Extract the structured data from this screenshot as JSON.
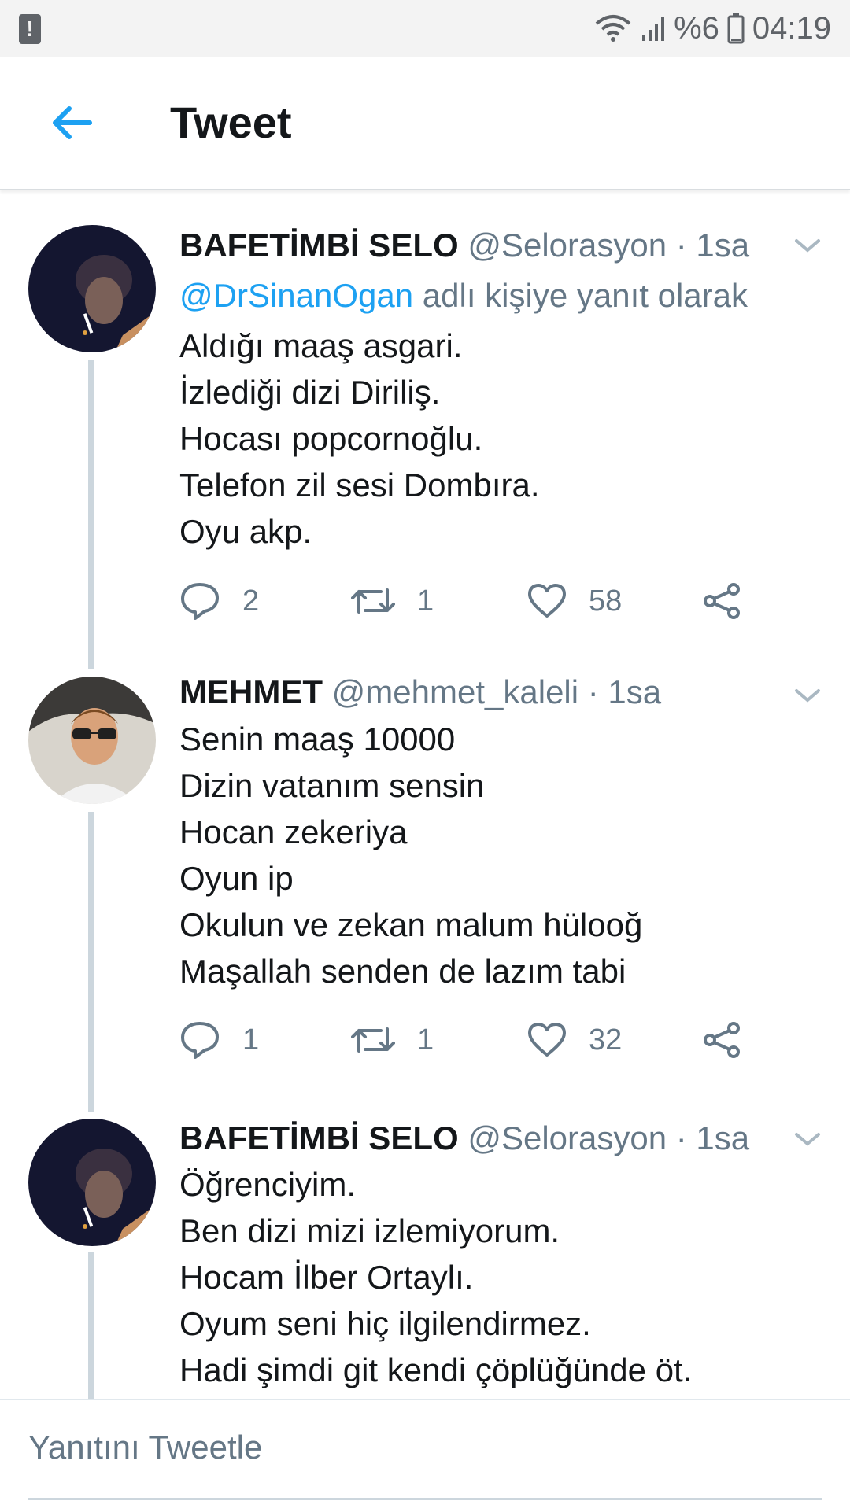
{
  "status_bar": {
    "battery_percent": "%6",
    "time": "04:19",
    "icons": [
      "alert-icon",
      "wifi-icon",
      "signal-icon",
      "battery-icon"
    ]
  },
  "header": {
    "title": "Tweet",
    "back_icon": "arrow-left-icon",
    "accent_color": "#1da1f2"
  },
  "tweets": [
    {
      "name": "BAFETİMBİ SELO",
      "handle": "@Selorasyon",
      "time": "· 1sa",
      "replying_mention": "@DrSinanOgan",
      "replying_text": "adlı kişiye yanıt olarak",
      "lines": [
        "Aldığı maaş asgari.",
        "İzlediği dizi Diriliş.",
        "Hocası popcornoğlu.",
        "Telefon zil sesi Dombıra.",
        "Oyu akp."
      ],
      "replies": "2",
      "retweets": "1",
      "likes": "58"
    },
    {
      "name": "MEHMET",
      "handle": "@mehmet_kaleli",
      "time": "· 1sa",
      "lines": [
        "Senin maaş 10000",
        "Dizin vatanım sensin",
        "Hocan zekeriya",
        "Oyun ip",
        "Okulun ve zekan malum hülooğ",
        "Maşallah senden de lazım tabi"
      ],
      "replies": "1",
      "retweets": "1",
      "likes": "32"
    },
    {
      "name": "BAFETİMBİ SELO",
      "handle": "@Selorasyon",
      "time": "· 1sa",
      "lines": [
        "Öğrenciyim.",
        "Ben dizi mizi izlemiyorum.",
        "Hocam İlber Ortaylı.",
        "Oyum seni hiç ilgilendirmez.",
        "Hadi şimdi git kendi çöplüğünde öt."
      ]
    }
  ],
  "reply_bar": {
    "placeholder": "Yanıtını Tweetle"
  }
}
